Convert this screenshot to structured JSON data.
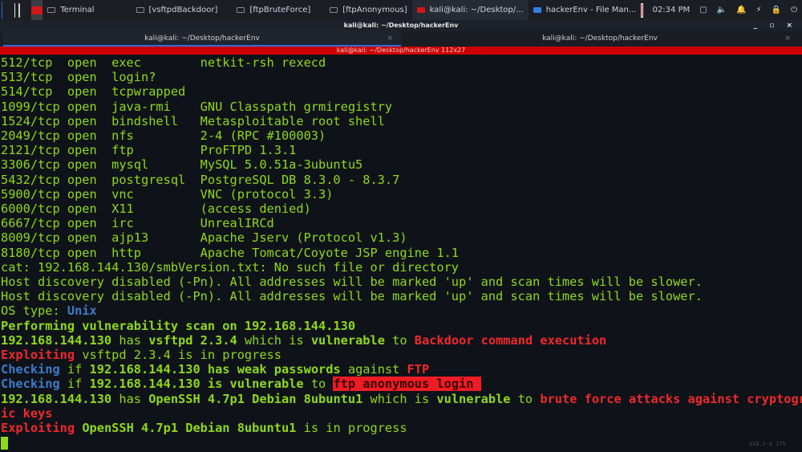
{
  "taskbar": {
    "tasks": [
      "Terminal",
      "[vsftpdBackdoor]",
      "[ftpBruteForce]",
      "[ftpAnonymous]",
      "kali@kali: ~/Desktop/...",
      "hackerEnv - File Man..."
    ],
    "clock": "02:34 PM"
  },
  "window": {
    "title": "kali@kali: ~/Desktop/hackerEnv",
    "controls": "_ ▫ ×"
  },
  "tabs": [
    {
      "label": "kali@kali: ~/Desktop/hackerEnv"
    },
    {
      "label": "kali@kali: ~/Desktop/hackerEnv"
    }
  ],
  "status": "kali@kali: ~/Desktop/hackerEnv 112x27",
  "terminal": {
    "ports": [
      "512/tcp  open  exec        netkit-rsh rexecd",
      "513/tcp  open  login?",
      "514/tcp  open  tcpwrapped",
      "1099/tcp open  java-rmi    GNU Classpath grmiregistry",
      "1524/tcp open  bindshell   Metasploitable root shell",
      "2049/tcp open  nfs         2-4 (RPC #100003)",
      "2121/tcp open  ftp         ProFTPD 1.3.1",
      "3306/tcp open  mysql       MySQL 5.0.51a-3ubuntu5",
      "5432/tcp open  postgresql  PostgreSQL DB 8.3.0 - 8.3.7",
      "5900/tcp open  vnc         VNC (protocol 3.3)",
      "6000/tcp open  X11         (access denied)",
      "6667/tcp open  irc         UnrealIRCd",
      "8009/tcp open  ajp13       Apache Jserv (Protocol v1.3)",
      "8180/tcp open  http        Apache Tomcat/Coyote JSP engine 1.1"
    ],
    "cat_err": "cat: 192.168.144.130/smbVersion.txt: No such file or directory",
    "host_disc": "Host discovery disabled (-Pn). All addresses will be marked 'up' and scan times will be slower.",
    "os_label": "OS type: ",
    "os_value": "Unix",
    "performing": "Performing vulnerability scan on 192.168.144.130",
    "l1": [
      "192.168.144.130",
      " has ",
      "vsftpd 2.3.4",
      " which is ",
      "vulnerable",
      " to ",
      "Backdoor command execution"
    ],
    "l2": [
      "Exploiting",
      " vsftpd 2.3.4 is in progress"
    ],
    "l3": [
      "Checking",
      " if ",
      "192.168.144.130 has weak passwords",
      " against ",
      "FTP"
    ],
    "l4": [
      "Checking",
      " if ",
      "192.168.144.130",
      " is vulnerable",
      " to ",
      "ftp anonymous login "
    ],
    "l5": [
      "192.168.144.130",
      " has ",
      "OpenSSH 4.7p1 Debian 8ubuntu1",
      " which is ",
      "vulnerable",
      " to ",
      "brute force attacks against cryptograph\nic keys"
    ],
    "l6": [
      "Exploiting",
      " OpenSSH 4.7p1 Debian 8ubuntu1",
      " is in progress"
    ],
    "ruler": "318,1-8        17%"
  },
  "colors": {
    "green": "#8fd81a",
    "red": "#f0282c",
    "blue": "#3d7bc9",
    "status_bar": "#cc0000"
  }
}
